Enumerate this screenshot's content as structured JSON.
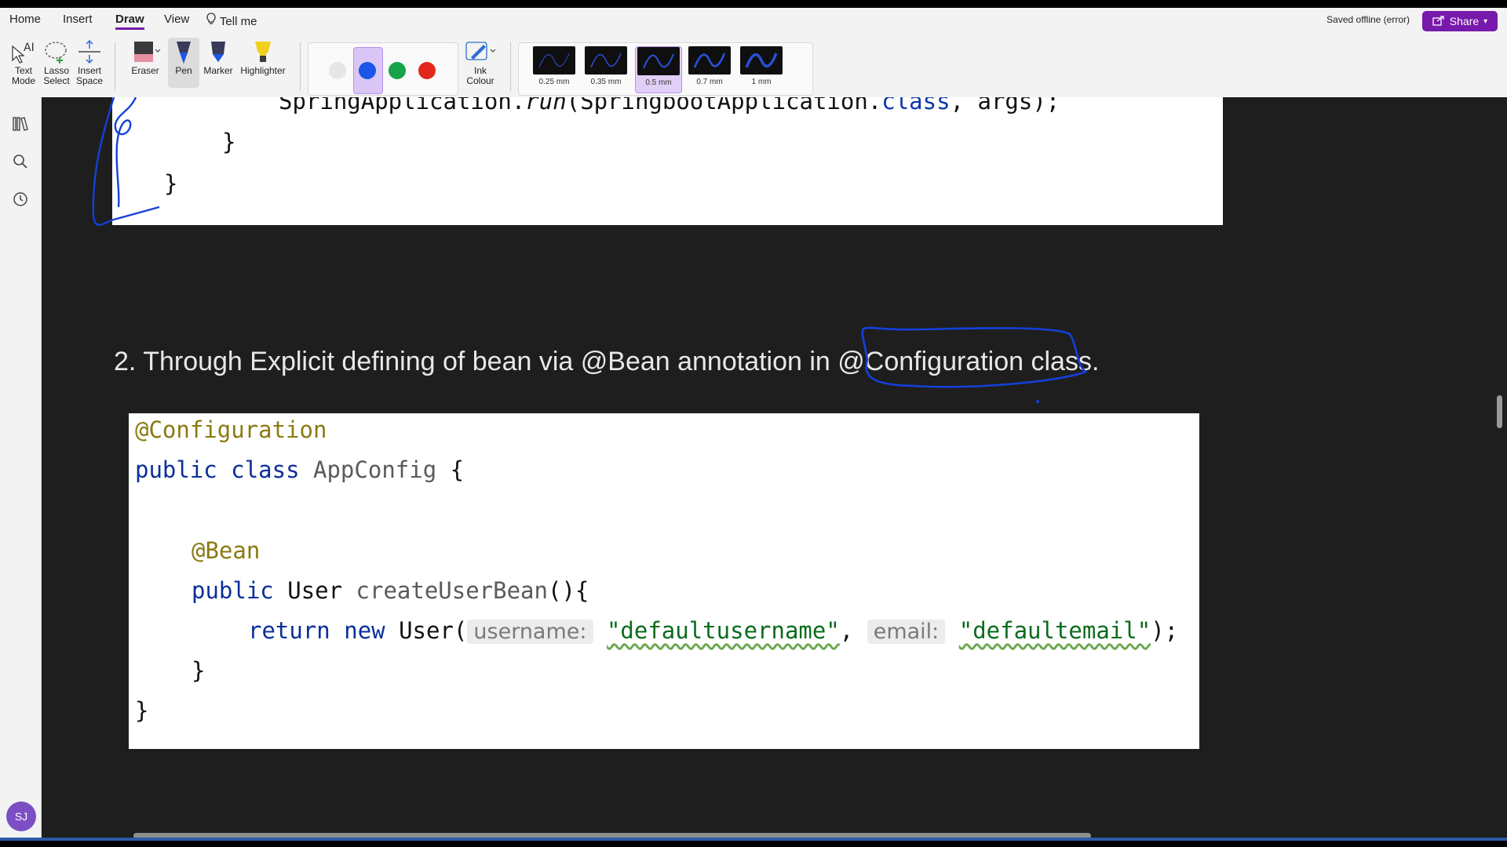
{
  "menu": {
    "home": "Home",
    "insert": "Insert",
    "draw": "Draw",
    "view": "View",
    "tell_me": "Tell me"
  },
  "status": "Saved offline (error)",
  "share_label": "Share",
  "tools": {
    "text_mode": [
      "Text",
      "Mode"
    ],
    "lasso_select": [
      "Lasso",
      "Select"
    ],
    "insert_space": [
      "Insert",
      "Space"
    ],
    "eraser": "Eraser",
    "pen": "Pen",
    "marker": "Marker",
    "highlighter": "Highlighter",
    "ink_colour": [
      "Ink",
      "Colour"
    ]
  },
  "colors": {
    "swatches": [
      "#e6e6e6",
      "#1a57e8",
      "#17a34a",
      "#e3261e"
    ],
    "selected_swatch_index": 1,
    "accent": "#7719aa",
    "ink_blue": "#1440d8"
  },
  "thickness": {
    "options": [
      "0.25 mm",
      "0.35 mm",
      "0.5 mm",
      "0.7 mm",
      "1 mm"
    ],
    "selected": "0.5 mm"
  },
  "sidebar": {
    "icons": [
      "library-icon",
      "search-icon",
      "history-icon"
    ],
    "avatar": "SJ"
  },
  "page": {
    "top_code": {
      "line1_prefix": "SpringApplication.",
      "line1_method": "run",
      "line1_mid": "(SpringbootApplication.",
      "line1_class": "class",
      "line1_end": ", args);",
      "brace_inner": "}",
      "brace_outer": "}"
    },
    "heading": "2.  Through Explicit defining of bean via @Bean annotation in @Configuration class.",
    "code": {
      "annotation_config": "@Configuration",
      "kw_public": "public",
      "kw_class": "class",
      "class_name": "AppConfig",
      "open_brace": "{",
      "annotation_bean": "@Bean",
      "method_kw_public": "public",
      "method_return_type": "User",
      "method_name": "createUserBean",
      "method_tail": "(){",
      "kw_return": "return",
      "kw_new": "new",
      "ctor": "User(",
      "hint_username": "username:",
      "str_username": "\"defaultusername\"",
      "comma": ",",
      "hint_email": "email:",
      "str_email": "\"defaultemail\"",
      "stmt_end": ");",
      "close_method": "}",
      "close_class": "}"
    }
  }
}
